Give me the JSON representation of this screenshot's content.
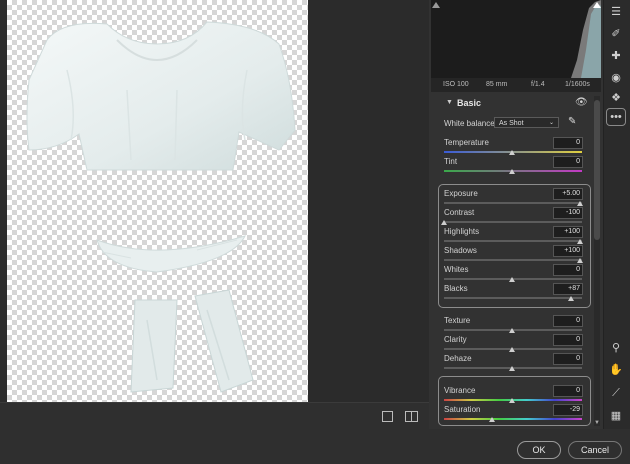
{
  "camera": {
    "iso": "ISO 100",
    "focal": "85 mm",
    "aperture": "f/1.4",
    "shutter": "1/1600s"
  },
  "section": {
    "title": "Basic"
  },
  "white_balance": {
    "label": "White balance",
    "value": "As Shot"
  },
  "sliders": [
    {
      "label": "Temperature",
      "value": "0",
      "pos": 0.5,
      "track": "temp"
    },
    {
      "label": "Tint",
      "value": "0",
      "pos": 0.5,
      "track": "tint"
    },
    {
      "label": "Exposure",
      "value": "+5.00",
      "pos": 1.0,
      "track": "gray"
    },
    {
      "label": "Contrast",
      "value": "-100",
      "pos": 0.0,
      "track": "gray"
    },
    {
      "label": "Highlights",
      "value": "+100",
      "pos": 1.0,
      "track": "gray"
    },
    {
      "label": "Shadows",
      "value": "+100",
      "pos": 1.0,
      "track": "gray"
    },
    {
      "label": "Whites",
      "value": "0",
      "pos": 0.5,
      "track": "gray"
    },
    {
      "label": "Blacks",
      "value": "+87",
      "pos": 0.935,
      "track": "gray"
    },
    {
      "label": "Texture",
      "value": "0",
      "pos": 0.5,
      "track": "gray"
    },
    {
      "label": "Clarity",
      "value": "0",
      "pos": 0.5,
      "track": "gray"
    },
    {
      "label": "Dehaze",
      "value": "0",
      "pos": 0.5,
      "track": "gray"
    },
    {
      "label": "Vibrance",
      "value": "0",
      "pos": 0.5,
      "track": "color"
    },
    {
      "label": "Saturation",
      "value": "-29",
      "pos": 0.355,
      "track": "color"
    }
  ],
  "buttons": {
    "ok": "OK",
    "cancel": "Cancel"
  },
  "icons": [
    "sliders-icon",
    "brush-icon",
    "healing-icon",
    "redeye-icon",
    "presets-icon",
    "more-icon",
    "zoom-icon",
    "hand-icon",
    "eyedropper-icon",
    "grid-icon"
  ],
  "colors": {
    "panel": "#323232",
    "canvas": "#2b2b2b",
    "histogram": "#1c1c1c"
  }
}
